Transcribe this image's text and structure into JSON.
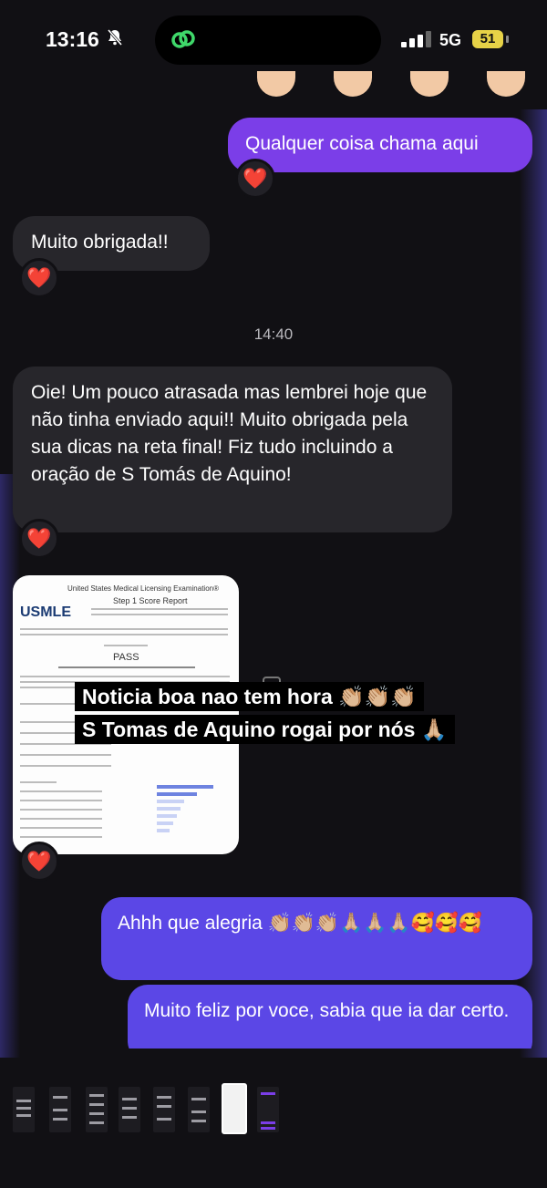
{
  "status_bar": {
    "time": "13:16",
    "network": "5G",
    "battery": "51",
    "icons": [
      "bell-slash-icon",
      "app-link-icon",
      "cellular-signal-icon",
      "battery-icon"
    ]
  },
  "messages": {
    "m1": "Qualquer coisa chama aqui",
    "m2": "Muito obrigada!!",
    "timestamp": "14:40",
    "m3": "Oie! Um pouco atrasada mas lembrei hoje que não tinha enviado aqui!! Muito obrigada pela sua dicas na reta final! Fiz tudo incluindo a oração de S Tomás de Aquino!",
    "m4": "Ahhh que alegria 👏🏼👏🏼👏🏼🙏🏼🙏🏼🙏🏼🥰🥰🥰",
    "m5": "Muito feliz por voce, sabia que ia dar certo."
  },
  "reaction": "❤️",
  "story_card": {
    "doc_title": "United States Medical Licensing Examination®",
    "doc_subtitle": "Step 1 Score Report",
    "logo": "USMLE",
    "result": "PASS"
  },
  "caption": {
    "line1": "Noticia boa nao tem hora 👏🏼👏🏼👏🏼",
    "line2": "S Tomas de Aquino rogai por nós 🙏🏼"
  },
  "accent_colors": {
    "outgoing": "#7b3ee8",
    "outgoing_alt": "#5b47e6",
    "incoming": "#27262b",
    "heart": "#e0243a"
  }
}
